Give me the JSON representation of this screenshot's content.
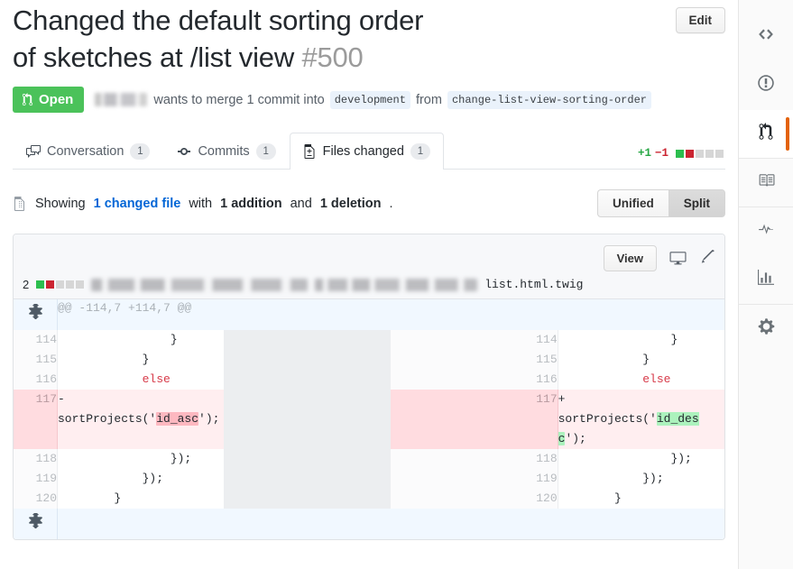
{
  "header": {
    "title_line1": "Changed the default sorting order",
    "title_line2": "of sketches at /list view",
    "number": "#500",
    "edit_label": "Edit"
  },
  "state": {
    "badge_label": "Open",
    "badge_color": "#4bc25a",
    "author_redacted": "",
    "merge_text": "wants to merge 1 commit into",
    "base_branch": "development",
    "from_text": "from",
    "head_branch": "change-list-view-sorting-order"
  },
  "tabs": [
    {
      "label": "Conversation",
      "count": "1",
      "icon": "comment-discussion-icon",
      "selected": false
    },
    {
      "label": "Commits",
      "count": "1",
      "icon": "git-commit-icon",
      "selected": false
    },
    {
      "label": "Files changed",
      "count": "1",
      "icon": "file-diff-icon",
      "selected": true
    }
  ],
  "diffstat": {
    "additions": "+1",
    "deletions": "−1",
    "blocks": [
      "g",
      "r",
      "n",
      "n",
      "n"
    ],
    "add_color": "#28a745",
    "del_color": "#cb2431"
  },
  "showing": {
    "prefix": "Showing",
    "changed_files": "1 changed file",
    "with_text": "with",
    "additions": "1 addition",
    "and_text": "and",
    "deletions": "1 deletion",
    "period": ".",
    "link_color": "#0366d6"
  },
  "view_toggle": {
    "unified_label": "Unified",
    "split_label": "Split",
    "selected": "Split"
  },
  "file": {
    "view_label": "View",
    "display_icon": "monitor-icon",
    "edit_icon": "pencil-icon",
    "change_count": "2",
    "blocks": [
      "g",
      "r",
      "n",
      "n",
      "n"
    ],
    "path_redacted": "",
    "filename": "list.html.twig"
  },
  "diff": {
    "hunk_header": "@@ -114,7 +114,7 @@",
    "expand_icon": "unfold-icon",
    "rows": [
      {
        "type": "ctx",
        "left_num": "114",
        "left_code": "                }",
        "right_num": "114",
        "right_code": "                }"
      },
      {
        "type": "ctx",
        "left_num": "115",
        "left_code": "            }",
        "right_num": "115",
        "right_code": "            }"
      },
      {
        "type": "ctx",
        "left_num": "116",
        "left_code": "            else",
        "right_num": "116",
        "right_code": "            else",
        "keyword": "else"
      },
      {
        "type": "change",
        "left_num": "117",
        "left_marker": "-",
        "left_code_pre": "sortProjects('",
        "left_code_hl": "id_asc",
        "left_code_post": "');",
        "right_num": "117",
        "right_marker": "+",
        "right_code_pre": "sortProjects('",
        "right_code_hl": "id_desc",
        "right_code_post": "');"
      },
      {
        "type": "ctx",
        "left_num": "118",
        "left_code": "                });",
        "right_num": "118",
        "right_code": "                });"
      },
      {
        "type": "ctx",
        "left_num": "119",
        "left_code": "            });",
        "right_num": "119",
        "right_code": "            });"
      },
      {
        "type": "ctx",
        "left_num": "120",
        "left_code": "        }",
        "right_num": "120",
        "right_code": "        }"
      }
    ]
  },
  "rail": [
    {
      "name": "code",
      "icon": "code-icon",
      "active": false
    },
    {
      "name": "issues",
      "icon": "issue-opened-icon",
      "active": false
    },
    {
      "name": "pull-requests",
      "icon": "git-pull-request-icon",
      "active": true
    },
    {
      "name": "wiki",
      "icon": "book-icon",
      "active": false
    },
    {
      "name": "pulse",
      "icon": "pulse-icon",
      "active": false
    },
    {
      "name": "graphs",
      "icon": "graph-icon",
      "active": false
    },
    {
      "name": "settings",
      "icon": "gear-icon",
      "active": false
    }
  ]
}
